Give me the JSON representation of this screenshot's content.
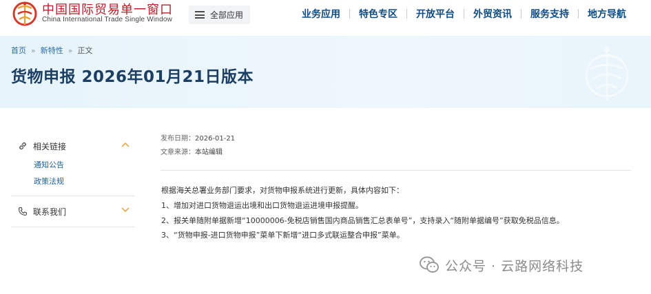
{
  "header": {
    "site_title": "中国国际贸易单一窗口",
    "site_subtitle": "China International Trade Single Window",
    "all_apps_label": "全部应用",
    "nav": [
      "业务应用",
      "特色专区",
      "开放平台",
      "外贸资讯",
      "服务支持",
      "地方导航"
    ]
  },
  "breadcrumb": {
    "home": "首页",
    "section": "新特性",
    "current": "正文"
  },
  "page_title": "货物申报 2026年01月21日版本",
  "sidebar": {
    "related_links": {
      "label": "相关链接",
      "items": [
        "通知公告",
        "政策法规"
      ]
    },
    "contact": {
      "label": "联系我们"
    }
  },
  "article": {
    "date_label": "发布日期：",
    "date": "2026-01-21",
    "source_label": "文章来源：",
    "source": "本站编辑",
    "paragraphs": [
      "根据海关总署业务部门要求，对货物申报系统进行更新，具体内容如下：",
      "1、增加对进口货物退运出境和出口货物退运进境申报提醒。",
      "2、报关单随附单据新增“10000006-免税店销售国内商品销售汇总表单号”，支持录入“随附单据编号”获取免税品信息。",
      "3、“货物申报-进口货物申报”菜单下新增“进口多式联运整合申报”菜单。"
    ]
  },
  "watermark": {
    "text": "公众号 · 云路网络科技",
    "icon": "wechat-icon"
  },
  "colors": {
    "brand_red": "#b8202a",
    "nav_blue": "#0f4c83",
    "title_navy": "#1d3e63",
    "link_blue": "#2b6aa8",
    "banner_bg": "#e7f4fb",
    "accent_orange": "#e8a23a"
  }
}
